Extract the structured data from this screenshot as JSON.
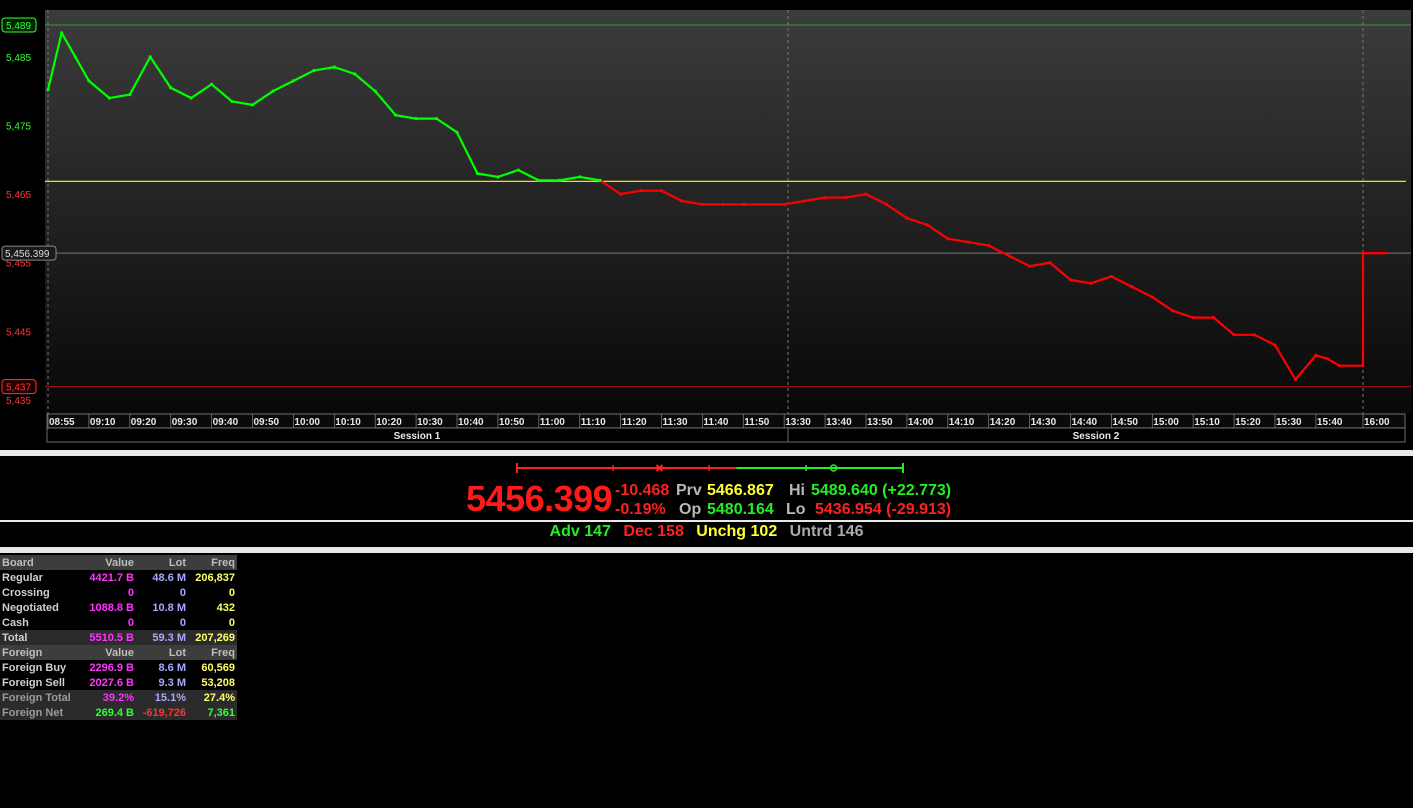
{
  "chart": {
    "y_axis_ticks": [
      "5,489",
      "5,485",
      "5,475",
      "5,465",
      "5,455",
      "5,445",
      "5,437",
      "5,435"
    ],
    "hi_marker": "5,489",
    "lo_marker": "5,437",
    "last_marker": "5,456.399",
    "prev_close_level": 5466.867,
    "time_ticks": [
      "08:55",
      "09:10",
      "09:20",
      "09:30",
      "09:40",
      "09:50",
      "10:00",
      "10:10",
      "10:20",
      "10:30",
      "10:40",
      "10:50",
      "11:00",
      "11:10",
      "11:20",
      "11:30",
      "11:40",
      "11:50",
      "13:30",
      "13:40",
      "13:50",
      "14:00",
      "14:10",
      "14:20",
      "14:30",
      "14:40",
      "14:50",
      "15:00",
      "15:10",
      "15:20",
      "15:30",
      "15:40",
      "16:00"
    ],
    "sessions": [
      "Session 1",
      "Session 2"
    ],
    "colors": {
      "up": "#00ff00",
      "down": "#ff0000",
      "prev": "#ffff00",
      "bg_top": "#3a3a3a",
      "bg_bottom": "#0a0a0a"
    }
  },
  "chart_data": {
    "type": "line",
    "x": [
      "08:55",
      "09:00",
      "09:05",
      "09:10",
      "09:15",
      "09:20",
      "09:25",
      "09:30",
      "09:35",
      "09:40",
      "09:45",
      "09:50",
      "09:55",
      "10:00",
      "10:05",
      "10:10",
      "10:15",
      "10:20",
      "10:25",
      "10:30",
      "10:35",
      "10:40",
      "10:45",
      "10:50",
      "10:55",
      "11:00",
      "11:05",
      "11:10",
      "11:15",
      "11:20",
      "11:25",
      "11:30",
      "11:35",
      "11:40",
      "11:45",
      "11:50",
      "11:55",
      "13:30",
      "13:35",
      "13:40",
      "13:45",
      "13:50",
      "13:55",
      "14:00",
      "14:05",
      "14:10",
      "14:15",
      "14:20",
      "14:25",
      "14:30",
      "14:35",
      "14:40",
      "14:45",
      "14:50",
      "14:55",
      "15:00",
      "15:05",
      "15:10",
      "15:15",
      "15:20",
      "15:25",
      "15:30",
      "15:35",
      "15:40",
      "15:45",
      "15:50",
      "16:00"
    ],
    "y": [
      5480.2,
      5488.5,
      5485.0,
      5481.5,
      5479.0,
      5479.5,
      5485.0,
      5480.5,
      5479.0,
      5481.0,
      5478.5,
      5478.0,
      5480.0,
      5481.5,
      5483.0,
      5483.5,
      5482.5,
      5480.0,
      5476.5,
      5476.0,
      5476.0,
      5474.0,
      5468.0,
      5467.5,
      5468.5,
      5467.0,
      5467.0,
      5467.5,
      5467.0,
      5465.0,
      5465.5,
      5465.5,
      5464.0,
      5463.5,
      5463.5,
      5463.5,
      5463.5,
      5463.5,
      5464.0,
      5464.5,
      5464.5,
      5465.0,
      5463.5,
      5461.5,
      5460.5,
      5458.5,
      5458.0,
      5457.5,
      5456.0,
      5454.5,
      5455.0,
      5452.5,
      5452.0,
      5453.0,
      5451.5,
      5450.0,
      5448.0,
      5447.0,
      5447.0,
      5444.5,
      5444.5,
      5443.0,
      5438.0,
      5441.5,
      5441.0,
      5440.0,
      5456.399
    ],
    "title": "",
    "xlabel": "",
    "ylabel": "",
    "ylim": [
      5435,
      5489.64
    ],
    "grid": true,
    "legend": "none"
  },
  "summary": {
    "last": "5456.399",
    "change": "-10.468",
    "change_pct": "-0.19%",
    "prv_label": "Prv",
    "prv": "5466.867",
    "op_label": "Op",
    "op": "5480.164",
    "hi_label": "Hi",
    "hi": "5489.640 (+22.773)",
    "lo_label": "Lo",
    "lo": "5436.954 (-29.913)",
    "day_range": {
      "low": 5436.954,
      "high": 5489.64,
      "prev": 5466.867,
      "open": 5480.164,
      "last": 5456.399
    }
  },
  "breadth": {
    "adv": "Adv 147",
    "dec": "Dec 158",
    "unchg": "Unchg 102",
    "untrd": "Untrd 146"
  },
  "board": {
    "header": [
      "Board",
      "Value",
      "Lot",
      "Freq"
    ],
    "rows": [
      {
        "name": "Regular",
        "value": "4421.7 B",
        "lot": "48.6 M",
        "freq": "206,837"
      },
      {
        "name": "Crossing",
        "value": "0",
        "lot": "0",
        "freq": "0"
      },
      {
        "name": "Negotiated",
        "value": "1088.8 B",
        "lot": "10.8 M",
        "freq": "432"
      },
      {
        "name": "Cash",
        "value": "0",
        "lot": "0",
        "freq": "0"
      },
      {
        "name": "Total",
        "value": "5510.5 B",
        "lot": "59.3 M",
        "freq": "207,269"
      }
    ],
    "foreign_header": [
      "Foreign",
      "Value",
      "Lot",
      "Freq"
    ],
    "foreign_rows": [
      {
        "name": "Foreign Buy",
        "value": "2296.9 B",
        "lot": "8.6 M",
        "freq": "60,569"
      },
      {
        "name": "Foreign Sell",
        "value": "2027.6 B",
        "lot": "9.3 M",
        "freq": "53,208"
      },
      {
        "name": "Foreign Total",
        "value": "39.2%",
        "lot": "15.1%",
        "freq": "27.4%"
      },
      {
        "name": "Foreign Net",
        "value": "269.4 B",
        "lot": "-619,726",
        "freq": "7,361"
      }
    ]
  }
}
